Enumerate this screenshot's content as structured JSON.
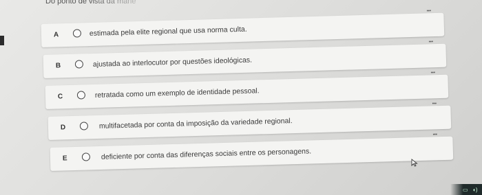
{
  "question_fragment": "Do ponto de vista da mane",
  "options": [
    {
      "letter": "A",
      "text": "estimada pela elite regional que usa norma culta.",
      "menu_label": "..."
    },
    {
      "letter": "B",
      "text": "ajustada ao interlocutor por questões ideológicas.",
      "menu_label": "..."
    },
    {
      "letter": "C",
      "text": "retratada como um exemplo de identidade pessoal.",
      "menu_label": "..."
    },
    {
      "letter": "D",
      "text": "multifacetada por conta da imposição da variedade regional.",
      "menu_label": "..."
    },
    {
      "letter": "E",
      "text": "deficiente por conta das diferenças sociais entre os personagens.",
      "menu_label": "..."
    }
  ],
  "icons": {
    "cursor": "mouse-pointer-icon",
    "taskbar": [
      "chat-icon",
      "volume-icon"
    ]
  }
}
